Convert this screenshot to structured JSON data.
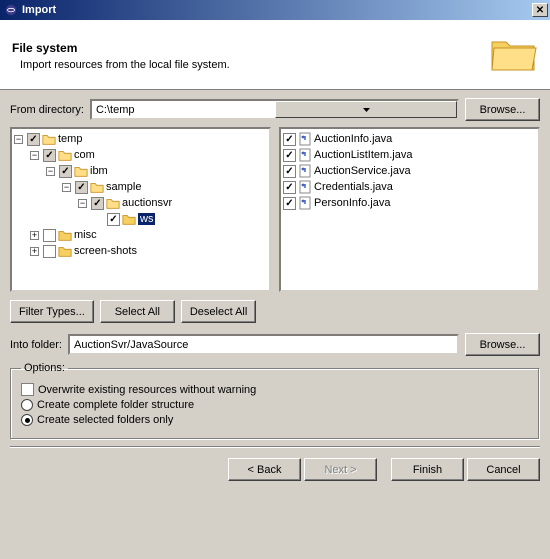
{
  "window": {
    "title": "Import"
  },
  "banner": {
    "title": "File system",
    "subtitle": "Import resources from the local file system."
  },
  "fromDir": {
    "label": "From directory:",
    "value": "C:\\temp",
    "browse": "Browse..."
  },
  "tree": [
    {
      "level": 0,
      "exp": "-",
      "check": "gray",
      "label": "temp"
    },
    {
      "level": 1,
      "exp": "-",
      "check": "gray",
      "label": "com"
    },
    {
      "level": 2,
      "exp": "-",
      "check": "gray",
      "label": "ibm"
    },
    {
      "level": 3,
      "exp": "-",
      "check": "gray",
      "label": "sample"
    },
    {
      "level": 4,
      "exp": "-",
      "check": "gray",
      "label": "auctionsvr"
    },
    {
      "level": 5,
      "exp": "",
      "check": "checked",
      "label": "ws",
      "sel": true
    },
    {
      "level": 1,
      "exp": "+",
      "check": "",
      "label": "misc"
    },
    {
      "level": 1,
      "exp": "+",
      "check": "",
      "label": "screen-shots"
    }
  ],
  "files": [
    {
      "check": true,
      "label": "AuctionInfo.java"
    },
    {
      "check": true,
      "label": "AuctionListItem.java"
    },
    {
      "check": true,
      "label": "AuctionService.java"
    },
    {
      "check": true,
      "label": "Credentials.java"
    },
    {
      "check": true,
      "label": "PersonInfo.java"
    }
  ],
  "buttons": {
    "filter": "Filter Types...",
    "selectAll": "Select All",
    "deselectAll": "Deselect All"
  },
  "intoFolder": {
    "label": "Into folder:",
    "value": "AuctionSvr/JavaSource",
    "browse": "Browse..."
  },
  "options": {
    "legend": "Options:",
    "overwrite": {
      "label": "Overwrite existing resources without warning",
      "checked": false
    },
    "complete": {
      "label": "Create complete folder structure",
      "sel": false
    },
    "selected": {
      "label": "Create selected folders only",
      "sel": true
    }
  },
  "footer": {
    "back": "< Back",
    "next": "Next >",
    "finish": "Finish",
    "cancel": "Cancel"
  }
}
